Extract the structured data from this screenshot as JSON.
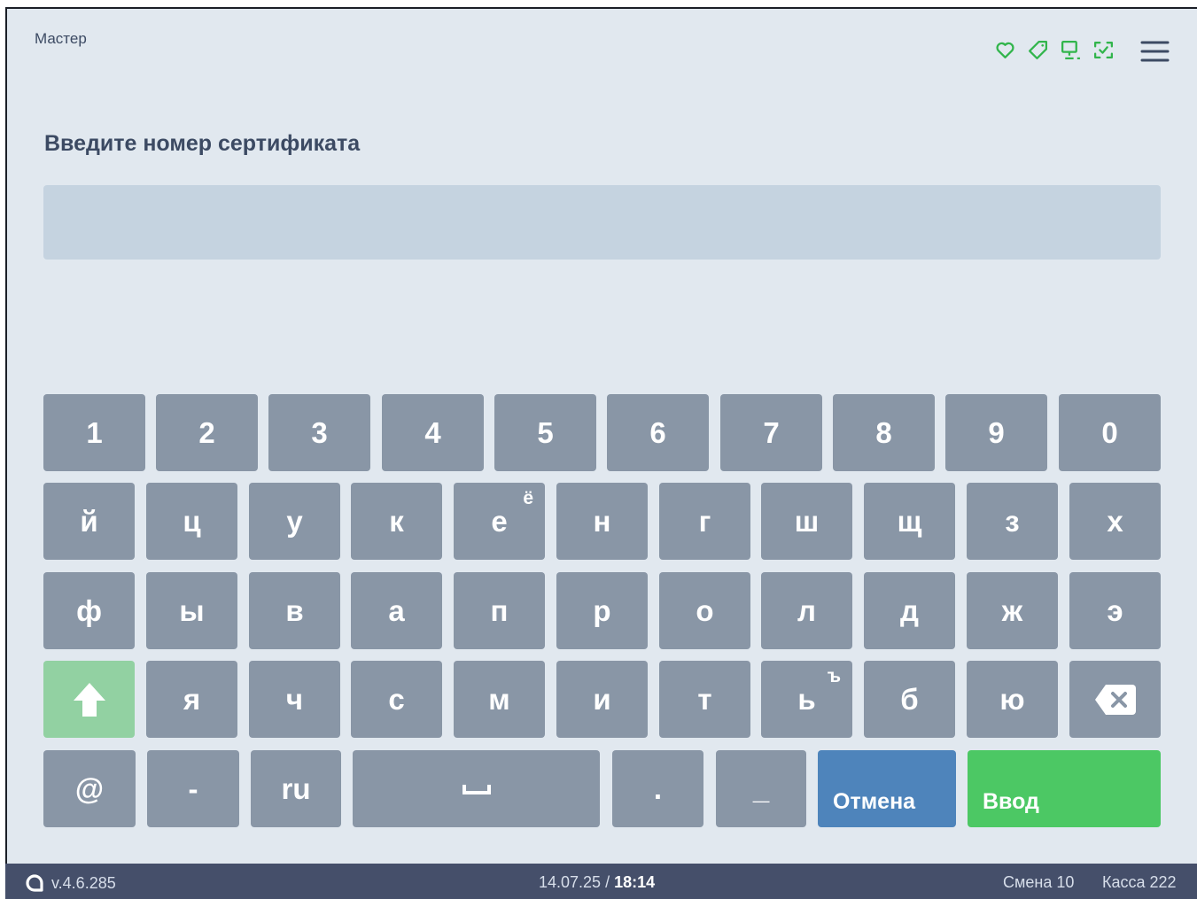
{
  "app": {
    "title": "Мастер"
  },
  "header": {
    "icons": [
      "heart-icon",
      "tag-icon",
      "monitor-icon",
      "scan-check-icon"
    ],
    "menu_icon": "hamburger-menu-icon",
    "icon_color": "#32b54c"
  },
  "prompt": {
    "label": "Введите номер сертификата"
  },
  "certificate_input": {
    "value": "",
    "placeholder": ""
  },
  "keyboard": {
    "digits": [
      "1",
      "2",
      "3",
      "4",
      "5",
      "6",
      "7",
      "8",
      "9",
      "0"
    ],
    "row1": [
      {
        "label": "й"
      },
      {
        "label": "ц"
      },
      {
        "label": "у"
      },
      {
        "label": "к"
      },
      {
        "label": "е",
        "alt": "ё"
      },
      {
        "label": "н"
      },
      {
        "label": "г"
      },
      {
        "label": "ш"
      },
      {
        "label": "щ"
      },
      {
        "label": "з"
      },
      {
        "label": "х"
      }
    ],
    "row2": [
      {
        "label": "ф"
      },
      {
        "label": "ы"
      },
      {
        "label": "в"
      },
      {
        "label": "а"
      },
      {
        "label": "п"
      },
      {
        "label": "р"
      },
      {
        "label": "о"
      },
      {
        "label": "л"
      },
      {
        "label": "д"
      },
      {
        "label": "ж"
      },
      {
        "label": "э"
      }
    ],
    "row3": [
      {
        "label": "я"
      },
      {
        "label": "ч"
      },
      {
        "label": "с"
      },
      {
        "label": "м"
      },
      {
        "label": "и"
      },
      {
        "label": "т"
      },
      {
        "label": "ь",
        "alt": "ъ"
      },
      {
        "label": "б"
      },
      {
        "label": "ю"
      }
    ],
    "shift_icon": "shift-arrow-up-icon",
    "backspace_icon": "backspace-icon",
    "bottom": {
      "at": "@",
      "dash": "-",
      "ru": "ru",
      "space_icon": "space-bar-icon",
      "dot": ".",
      "underscore": "_",
      "cancel": "Отмена",
      "enter": "Ввод"
    },
    "colors": {
      "key": "#8996a6",
      "shift": "#92d1a2",
      "cancel": "#4e84bb",
      "enter": "#4cc864"
    }
  },
  "status_bar": {
    "logo_icon": "app-logo-icon",
    "version": "v.4.6.285",
    "date": "14.07.25",
    "separator": "/",
    "time": "18:14",
    "shift": "Смена 10",
    "register": "Касса 222"
  }
}
